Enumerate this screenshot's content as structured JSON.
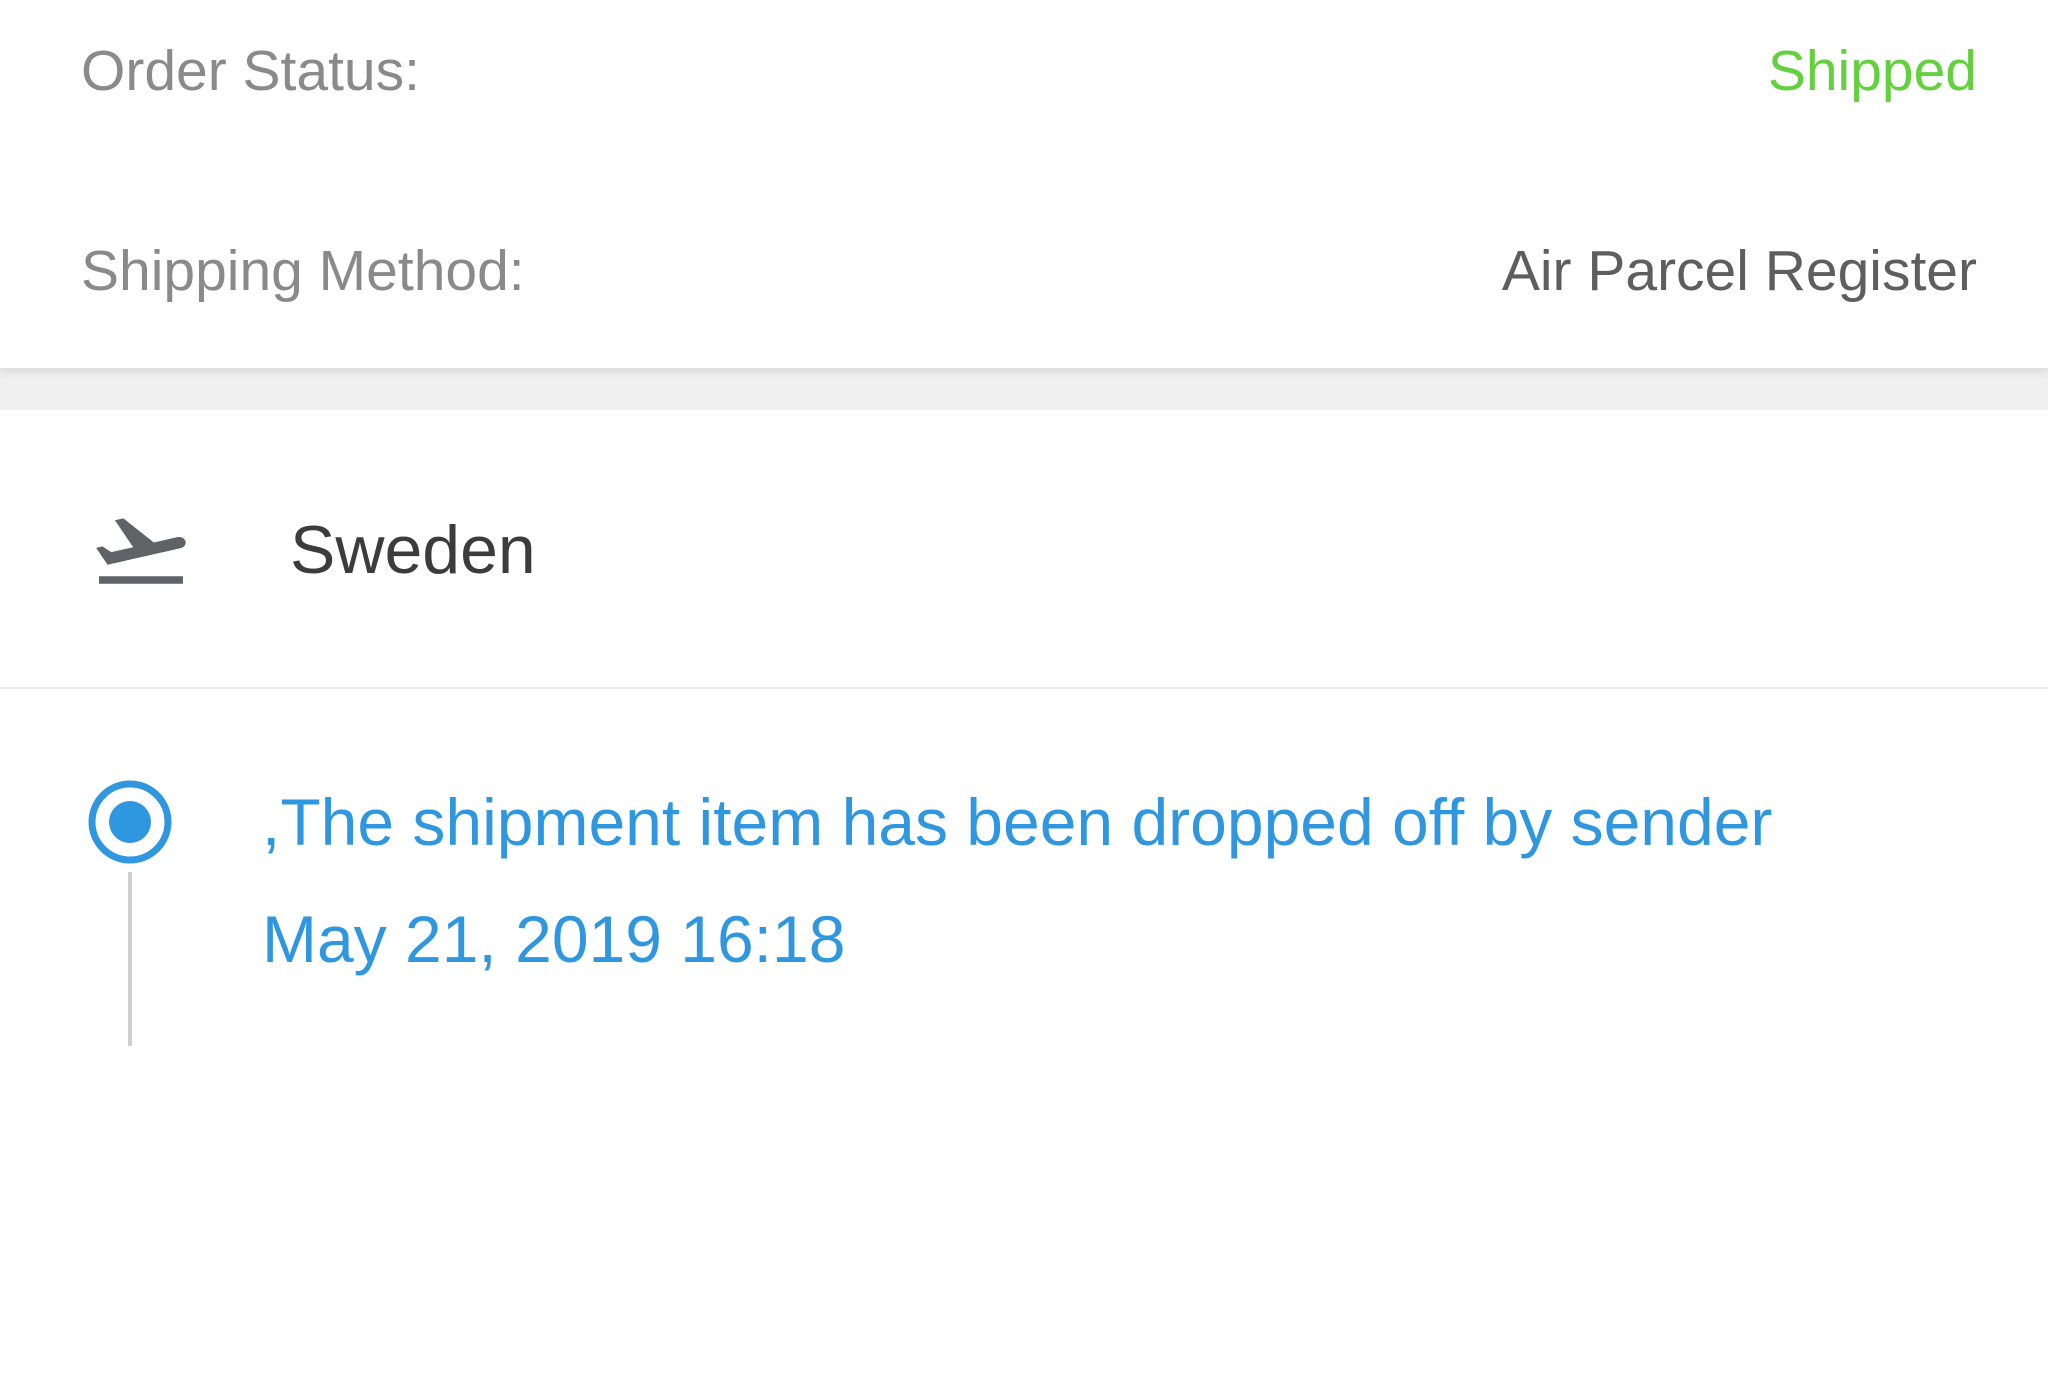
{
  "order": {
    "status_label": "Order Status:",
    "status_value": "Shipped",
    "method_label": "Shipping Method:",
    "method_value": "Air Parcel Register"
  },
  "destination": {
    "icon": "airplane-takeoff-icon",
    "country": "Sweden"
  },
  "tracking": {
    "events": [
      {
        "description": ",The shipment item has been dropped off by sender",
        "datetime": "May 21, 2019 16:18"
      }
    ]
  },
  "colors": {
    "status_shipped": "#63d13e",
    "timeline_accent": "#2f96e0",
    "label_gray": "#8a8a8a",
    "icon_gray": "#5f6368"
  }
}
